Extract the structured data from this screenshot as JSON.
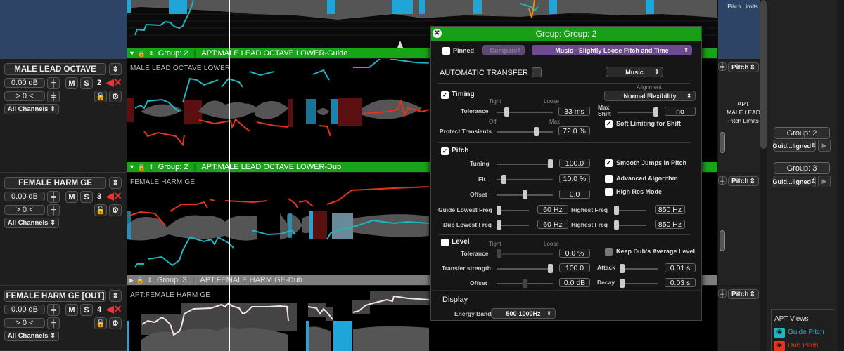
{
  "tracks": [
    {
      "name": "MALE LEAD OCTAVE",
      "volume": "0.00 dB",
      "pan": "> 0 <",
      "channels": "All Channels",
      "number": "2",
      "lane_label": "MALE LEAD OCTAVE LOWER"
    },
    {
      "name": "FEMALE HARM GE",
      "volume": "0.00 dB",
      "pan": "> 0 <",
      "channels": "All Channels",
      "number": "3",
      "lane_label": "FEMALE HARM GE"
    },
    {
      "name": "FEMALE HARM GE [OUT]",
      "volume": "0.00 dB",
      "pan": "> 0 <",
      "channels": "All Channels",
      "number": "4",
      "lane_label": "APT:FEMALE HARM GE"
    }
  ],
  "buttons": {
    "mute": "M",
    "solo": "S"
  },
  "group_bars": [
    {
      "group": "Group: 2",
      "name": "APT:MALE LEAD OCTAVE LOWER-Guide",
      "color": "#19a319"
    },
    {
      "group": "Group: 2",
      "name": "APT:MALE LEAD OCTAVE LOWER-Dub",
      "color": "#19a319"
    },
    {
      "group": "Group: 3",
      "name": "APT:FEMALE HARM GE-Dub",
      "color": "#7d7d7d"
    }
  ],
  "right_strip": {
    "pitch_label": "Pitch",
    "top_pitch_limits": "Pitch Limits",
    "pitch_limits_text": [
      "APT",
      "MALE LEAD",
      "Pitch Limits"
    ]
  },
  "sidebar": {
    "groups": [
      {
        "label": "Group: 2",
        "mode": "Guid...ligned"
      },
      {
        "label": "Group: 3",
        "mode": "Guid...ligned"
      }
    ],
    "apt_views": {
      "title": "APT Views",
      "guide": "Guide Pitch",
      "dub": "Dub Pitch",
      "guide_color": "#1fb5c0",
      "dub_color": "#e8321c"
    }
  },
  "dialog": {
    "title": "Group: Group: 2",
    "pinned_label": "Pinned",
    "pinned": false,
    "compare_label": "Compare",
    "preset": "Music - Slightly Loose Pitch and Time",
    "auto_transfer_label": "AUTOMATIC TRANSFER",
    "auto_transfer_mode": "Music",
    "timing": {
      "label": "Timing",
      "enabled": true,
      "alignment_label": "Alignment",
      "alignment": "Normal Flexibility",
      "tight": "Tight",
      "loose": "Loose",
      "tolerance_label": "Tolerance",
      "tolerance": "33 ms",
      "tolerance_pos": 0.15,
      "max_shift_label": [
        "Max",
        "Shift"
      ],
      "max_shift": "no",
      "max_shift_pos": 1.0,
      "off": "Off",
      "max": "Max",
      "protect_label": "Protect Transients",
      "protect": "72.0 %",
      "protect_pos": 0.72,
      "soft_limit_label": "Soft Limiting for Shift",
      "soft_limit": true
    },
    "pitch": {
      "label": "Pitch",
      "enabled": true,
      "tuning_label": "Tuning",
      "tuning": "100.0",
      "tuning_pos": 1.0,
      "fit_label": "Fit",
      "fit": "10.0 %",
      "fit_pos": 0.1,
      "offset_label": "Offset",
      "offset": "0.0",
      "offset_pos": 0.5,
      "smooth_label": "Smooth Jumps in Pitch",
      "smooth": true,
      "advanced_label": "Advanced Algorithm",
      "advanced": false,
      "highres_label": "High Res Mode",
      "highres": false,
      "guide_low_label": "Guide Lowest Freq",
      "guide_low": "60 Hz",
      "guide_high_label": "Highest Freq",
      "guide_high": "850 Hz",
      "dub_low_label": "Dub Lowest Freq",
      "dub_low": "60 Hz",
      "dub_high_label": "Highest Freq",
      "dub_high": "850 Hz"
    },
    "level": {
      "label": "Level",
      "enabled": false,
      "tight": "Tight",
      "loose": "Loose",
      "tolerance_label": "Tolerance",
      "tolerance": "0.0 %",
      "tolerance_pos": 0.0,
      "keep_label": "Keep Dub's Average Level",
      "keep": false,
      "strength_label": "Transfer strength",
      "strength": "100.0",
      "strength_pos": 1.0,
      "attack_label": "Attack",
      "attack": "0.01 s",
      "offset_label": "Offset",
      "offset": "0.0 dB",
      "offset_pos": 0.5,
      "decay_label": "Decay",
      "decay": "0.03 s"
    },
    "display": {
      "label": "Display",
      "energy_label": "Energy Band",
      "energy": "500-1000Hz"
    }
  }
}
